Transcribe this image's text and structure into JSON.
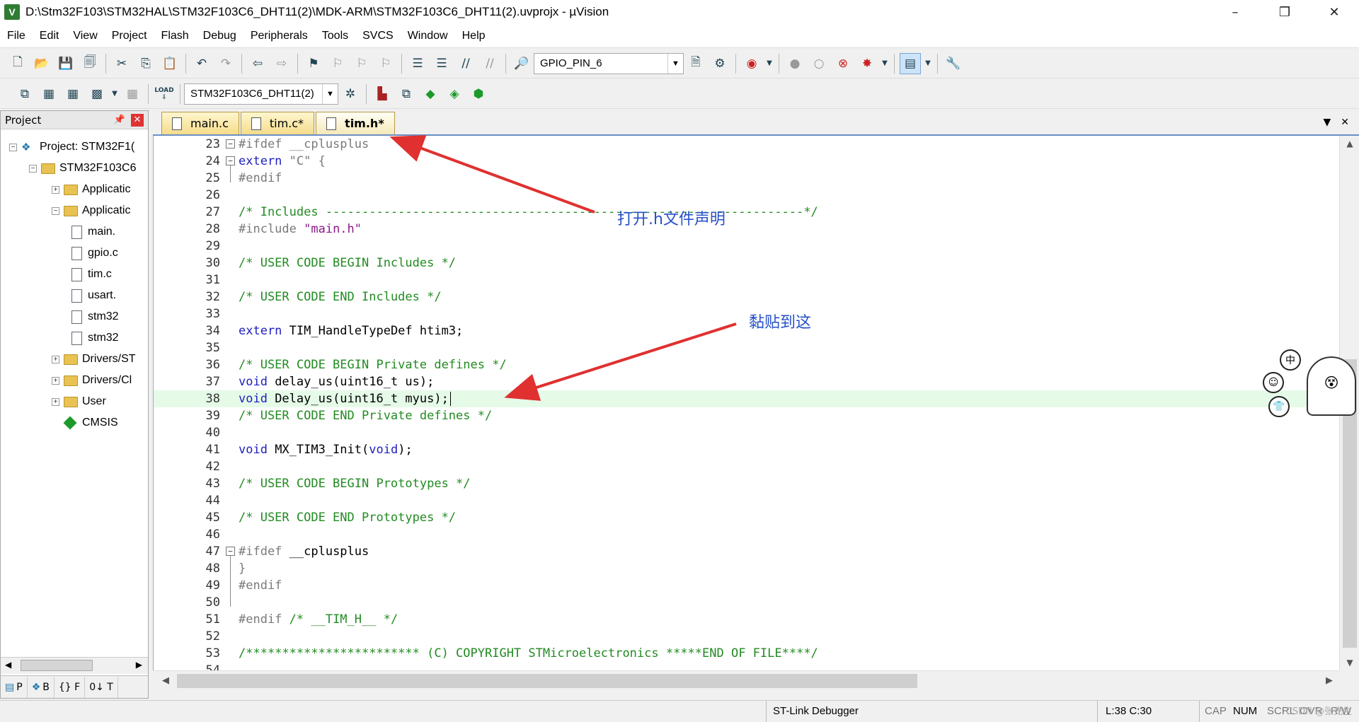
{
  "window": {
    "app_icon": "V",
    "title": "D:\\Stm32F103\\STM32HAL\\STM32F103C6_DHT11(2)\\MDK-ARM\\STM32F103C6_DHT11(2).uvprojx - µVision",
    "minimize": "–",
    "maximize": "❐",
    "close": "✕"
  },
  "menu": [
    "File",
    "Edit",
    "View",
    "Project",
    "Flash",
    "Debug",
    "Peripherals",
    "Tools",
    "SVCS",
    "Window",
    "Help"
  ],
  "toolbar1": {
    "find_combo_value": "GPIO_PIN_6"
  },
  "toolbar2": {
    "load_label": "LOAD",
    "target_combo_value": "STM32F103C6_DHT11(2)"
  },
  "project_panel": {
    "title": "Project",
    "tree": [
      {
        "label": "Project: STM32F1(",
        "level": 0,
        "toggle": "−",
        "icon": "project"
      },
      {
        "label": "STM32F103C6",
        "level": 1,
        "toggle": "−",
        "icon": "target"
      },
      {
        "label": "Applicatic",
        "level": 2,
        "toggle": "+",
        "icon": "folder"
      },
      {
        "label": "Applicatic",
        "level": 2,
        "toggle": "−",
        "icon": "folder"
      },
      {
        "label": "main.",
        "level": 3,
        "toggle": "",
        "icon": "file"
      },
      {
        "label": "gpio.c",
        "level": 3,
        "toggle": "",
        "icon": "file"
      },
      {
        "label": "tim.c",
        "level": 3,
        "toggle": "",
        "icon": "file"
      },
      {
        "label": "usart.",
        "level": 3,
        "toggle": "",
        "icon": "file"
      },
      {
        "label": "stm32",
        "level": 3,
        "toggle": "",
        "icon": "file"
      },
      {
        "label": "stm32",
        "level": 3,
        "toggle": "",
        "icon": "file"
      },
      {
        "label": "Drivers/ST",
        "level": 2,
        "toggle": "+",
        "icon": "folder"
      },
      {
        "label": "Drivers/Cl",
        "level": 2,
        "toggle": "+",
        "icon": "folder"
      },
      {
        "label": "User",
        "level": 2,
        "toggle": "+",
        "icon": "folder"
      },
      {
        "label": "CMSIS",
        "level": 2,
        "toggle": "",
        "icon": "cmsis"
      }
    ],
    "bottom_tabs": [
      "P",
      "B",
      "{} F",
      "0↓ T"
    ]
  },
  "editor": {
    "tabs": [
      {
        "label": "main.c",
        "active": false
      },
      {
        "label": "tim.c*",
        "active": false
      },
      {
        "label": "tim.h*",
        "active": true
      }
    ],
    "current_line": 38,
    "lines": [
      {
        "no": "23",
        "fold": "−",
        "parts": [
          {
            "c": "pp",
            "t": "#ifdef __cplusplus"
          }
        ]
      },
      {
        "no": "24",
        "fold": "−",
        "parts": [
          {
            "c": "kw",
            "t": "extern "
          },
          {
            "c": "pp",
            "t": "\"C\" {"
          }
        ]
      },
      {
        "no": "25",
        "fold": "",
        "parts": [
          {
            "c": "pp",
            "t": "#endif"
          }
        ]
      },
      {
        "no": "26",
        "fold": "",
        "parts": []
      },
      {
        "no": "27",
        "fold": "",
        "parts": [
          {
            "c": "cm",
            "t": "/* Includes ------------------------------------------------------------------*/"
          }
        ]
      },
      {
        "no": "28",
        "fold": "",
        "parts": [
          {
            "c": "pp",
            "t": "#include "
          },
          {
            "c": "st",
            "t": "\"main.h\""
          }
        ]
      },
      {
        "no": "29",
        "fold": "",
        "parts": []
      },
      {
        "no": "30",
        "fold": "",
        "parts": [
          {
            "c": "cm",
            "t": "/* USER CODE BEGIN Includes */"
          }
        ]
      },
      {
        "no": "31",
        "fold": "",
        "parts": []
      },
      {
        "no": "32",
        "fold": "",
        "parts": [
          {
            "c": "cm",
            "t": "/* USER CODE END Includes */"
          }
        ]
      },
      {
        "no": "33",
        "fold": "",
        "parts": []
      },
      {
        "no": "34",
        "fold": "",
        "parts": [
          {
            "c": "kw",
            "t": "extern "
          },
          {
            "c": "plain",
            "t": "TIM_HandleTypeDef htim3;"
          }
        ]
      },
      {
        "no": "35",
        "fold": "",
        "parts": []
      },
      {
        "no": "36",
        "fold": "",
        "parts": [
          {
            "c": "cm",
            "t": "/* USER CODE BEGIN Private defines */"
          }
        ]
      },
      {
        "no": "37",
        "fold": "",
        "parts": [
          {
            "c": "kw",
            "t": "void "
          },
          {
            "c": "plain",
            "t": "delay_us(uint16_t us);"
          }
        ]
      },
      {
        "no": "38",
        "fold": "",
        "parts": [
          {
            "c": "kw",
            "t": "void "
          },
          {
            "c": "plain",
            "t": "Delay_us(uint16_t myus);"
          }
        ]
      },
      {
        "no": "39",
        "fold": "",
        "parts": [
          {
            "c": "cm",
            "t": "/* USER CODE END Private defines */"
          }
        ]
      },
      {
        "no": "40",
        "fold": "",
        "parts": []
      },
      {
        "no": "41",
        "fold": "",
        "parts": [
          {
            "c": "kw",
            "t": "void "
          },
          {
            "c": "plain",
            "t": "MX_TIM3_Init("
          },
          {
            "c": "kw",
            "t": "void"
          },
          {
            "c": "plain",
            "t": ");"
          }
        ]
      },
      {
        "no": "42",
        "fold": "",
        "parts": []
      },
      {
        "no": "43",
        "fold": "",
        "parts": [
          {
            "c": "cm",
            "t": "/* USER CODE BEGIN Prototypes */"
          }
        ]
      },
      {
        "no": "44",
        "fold": "",
        "parts": []
      },
      {
        "no": "45",
        "fold": "",
        "parts": [
          {
            "c": "cm",
            "t": "/* USER CODE END Prototypes */"
          }
        ]
      },
      {
        "no": "46",
        "fold": "",
        "parts": []
      },
      {
        "no": "47",
        "fold": "−",
        "parts": [
          {
            "c": "pp",
            "t": "#ifdef "
          },
          {
            "c": "plain",
            "t": "__cplusplus"
          }
        ]
      },
      {
        "no": "48",
        "fold": "",
        "parts": [
          {
            "c": "pp",
            "t": "}"
          }
        ]
      },
      {
        "no": "49",
        "fold": "",
        "parts": [
          {
            "c": "pp",
            "t": "#endif"
          }
        ]
      },
      {
        "no": "50",
        "fold": "",
        "parts": []
      },
      {
        "no": "51",
        "fold": "",
        "parts": [
          {
            "c": "pp",
            "t": "#endif "
          },
          {
            "c": "cm",
            "t": "/* __TIM_H__ */"
          }
        ]
      },
      {
        "no": "52",
        "fold": "",
        "parts": []
      },
      {
        "no": "53",
        "fold": "",
        "parts": [
          {
            "c": "cm",
            "t": "/************************ (C) COPYRIGHT STMicroelectronics *****END OF FILE****/"
          }
        ]
      },
      {
        "no": "54",
        "fold": "",
        "parts": []
      }
    ]
  },
  "annotations": {
    "note1": "打开.h文件声明",
    "note2": "黏贴到这",
    "arrow_color": "#e03030",
    "text_color": "#2650c8"
  },
  "ime": {
    "mode": "中"
  },
  "statusbar": {
    "debugger": "ST-Link Debugger",
    "position": "L:38 C:30",
    "caps": "CAP",
    "num": "NUM",
    "scrl": "SCRL",
    "ovr": "OVR",
    "rw": "R/W"
  },
  "watermark": "CSDN @张先生"
}
